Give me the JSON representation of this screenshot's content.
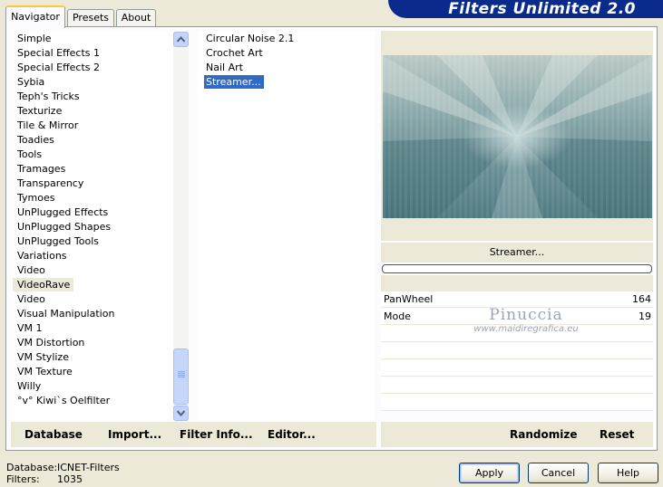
{
  "app": {
    "title": "Filters Unlimited 2.0"
  },
  "tabs": [
    {
      "label": "Navigator",
      "active": true
    },
    {
      "label": "Presets",
      "active": false
    },
    {
      "label": "About",
      "active": false
    }
  ],
  "categories": {
    "items": [
      "Simple",
      "Special Effects 1",
      "Special Effects 2",
      "Sybia",
      "Teph's Tricks",
      "Texturize",
      "Tile & Mirror",
      "Toadies",
      "Tools",
      "Tramages",
      "Transparency",
      "Tymoes",
      "UnPlugged Effects",
      "UnPlugged Shapes",
      "UnPlugged Tools",
      "Variations",
      "Video",
      "VideoRave",
      "Video",
      "Visual Manipulation",
      "VM 1",
      "VM Distortion",
      "VM Stylize",
      "VM Texture",
      "Willy",
      "°v° Kiwi`s Oelfilter"
    ],
    "selected": "VideoRave"
  },
  "filters": {
    "items": [
      "Circular Noise 2.1",
      "Crochet Art",
      "Nail Art",
      "Streamer..."
    ],
    "selected": "Streamer..."
  },
  "left_buttons": {
    "database": "Database",
    "import": "Import...",
    "filter_info": "Filter Info...",
    "editor": "Editor..."
  },
  "preview": {
    "filter_name": "Streamer...",
    "progress": 0
  },
  "params": [
    {
      "label": "PanWheel",
      "value": "164"
    },
    {
      "label": "Mode",
      "value": "19"
    }
  ],
  "watermark": {
    "name": "Pinuccia",
    "url": "www.maidiregrafica.eu"
  },
  "right_buttons": {
    "randomize": "Randomize",
    "reset": "Reset"
  },
  "status": {
    "database_label": "Database:",
    "database_value": "ICNET-Filters",
    "filters_label": "Filters:",
    "filters_value": "1035"
  },
  "dialog_buttons": {
    "apply": "Apply",
    "cancel": "Cancel",
    "help": "Help"
  },
  "colors": {
    "banner": "#0a2a8c",
    "selection": "#316ac5",
    "panel_bg": "#ece9d8"
  }
}
